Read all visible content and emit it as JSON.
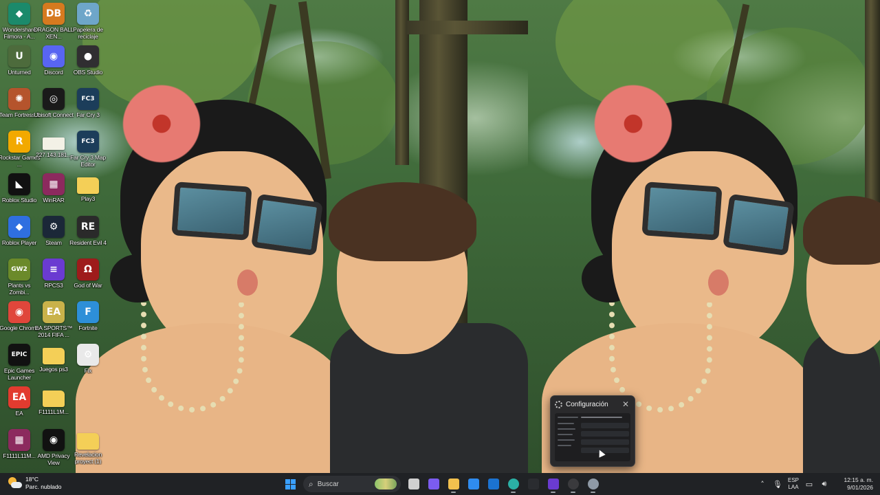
{
  "desktop": {
    "icons": [
      {
        "id": "filmora",
        "label": "Wondershare Filmora - A...",
        "glyph": "◆",
        "color": "#1b8a6b",
        "icon": "filmora-icon"
      },
      {
        "id": "dragonball",
        "label": "DRAGON BALL XEN...",
        "glyph": "DB",
        "color": "#d67a1f",
        "icon": "dragonball-icon"
      },
      {
        "id": "recycle",
        "label": "Papelera de reciclaje",
        "glyph": "♻",
        "color": "#6ea6c9",
        "icon": "recycle-bin-icon"
      },
      {
        "id": "unturned",
        "label": "Unturned",
        "glyph": "U",
        "color": "#4d6b3c",
        "icon": "unturned-icon"
      },
      {
        "id": "discord",
        "label": "Discord",
        "glyph": "◉",
        "color": "#5865f2",
        "icon": "discord-icon"
      },
      {
        "id": "obs",
        "label": "OBS Studio",
        "glyph": "●",
        "color": "#302e31",
        "icon": "obs-icon"
      },
      {
        "id": "tf2",
        "label": "Team Fortress 2",
        "glyph": "✺",
        "color": "#b5542c",
        "icon": "tf2-icon"
      },
      {
        "id": "ubisoft",
        "label": "Ubisoft Connect",
        "glyph": "◎",
        "color": "#1a1a1a",
        "icon": "ubisoft-icon"
      },
      {
        "id": "farcry3",
        "label": "Far Cry 3",
        "glyph": "FC3",
        "color": "#1c3d5a",
        "icon": "farcry3-icon"
      },
      {
        "id": "rockstar",
        "label": "Rockstar Games ...",
        "glyph": "R",
        "color": "#f2a900",
        "icon": "rockstar-icon"
      },
      {
        "id": "ipfile",
        "label": "227.143.181...",
        "glyph": "",
        "color": "#f3f1e6",
        "icon": "file-icon"
      },
      {
        "id": "farcry3editor",
        "label": "Far Cry 3 Map Editor",
        "glyph": "FC3",
        "color": "#1c3d5a",
        "icon": "farcry3-editor-icon"
      },
      {
        "id": "robloxstudio",
        "label": "Roblox Studio",
        "glyph": "◣",
        "color": "#111111",
        "icon": "roblox-studio-icon"
      },
      {
        "id": "winrar",
        "label": "WinRAR",
        "glyph": "▦",
        "color": "#8c2a5e",
        "icon": "winrar-icon"
      },
      {
        "id": "play3",
        "label": "Play3",
        "glyph": "",
        "color": "#f4cf57",
        "icon": "folder-icon"
      },
      {
        "id": "robloxplayer",
        "label": "Roblox Player",
        "glyph": "◆",
        "color": "#2f6fe0",
        "icon": "roblox-player-icon"
      },
      {
        "id": "steam",
        "label": "Steam",
        "glyph": "⚙",
        "color": "#1b2838",
        "icon": "steam-icon"
      },
      {
        "id": "re4",
        "label": "Resident Evil 4",
        "glyph": "RE",
        "color": "#2a2a2a",
        "icon": "resident-evil-icon"
      },
      {
        "id": "pvz",
        "label": "Plants vs Zombi...",
        "glyph": "GW2",
        "color": "#6b8a2a",
        "icon": "plants-vs-zombies-icon"
      },
      {
        "id": "rpcs3",
        "label": "RPCS3",
        "glyph": "≡",
        "color": "#6a3bd1",
        "icon": "rpcs3-icon"
      },
      {
        "id": "gow",
        "label": "God of War",
        "glyph": "Ω",
        "color": "#9e1b1b",
        "icon": "god-of-war-icon"
      },
      {
        "id": "chrome",
        "label": "Google Chrome",
        "glyph": "◉",
        "color": "#e0463b",
        "icon": "chrome-icon"
      },
      {
        "id": "fifa",
        "label": "EA SPORTS™ 2014 FIFA ...",
        "glyph": "EA",
        "color": "#c9b24a",
        "icon": "fifa-icon"
      },
      {
        "id": "fortnite",
        "label": "Fortnite",
        "glyph": "F",
        "color": "#2d8fd8",
        "icon": "fortnite-icon"
      },
      {
        "id": "epic",
        "label": "Epic Games Launcher",
        "glyph": "EPIC",
        "color": "#111111",
        "icon": "epic-games-icon"
      },
      {
        "id": "juegosps3",
        "label": "Juegos ps3",
        "glyph": "",
        "color": "#f4cf57",
        "icon": "folder-icon"
      },
      {
        "id": "fix",
        "label": "Fix",
        "glyph": "⚙",
        "color": "#e9e9e9",
        "icon": "settings-file-icon"
      },
      {
        "id": "ea",
        "label": "EA",
        "glyph": "EA",
        "color": "#e23b2f",
        "icon": "ea-icon"
      },
      {
        "id": "f1111",
        "label": "F1111L1M...",
        "glyph": "",
        "color": "#f4cf57",
        "icon": "folder-icon"
      },
      {
        "id": "f1111b",
        "label": "F1111L11M...",
        "glyph": "▦",
        "color": "#8c2a5e",
        "icon": "winrar-archive-icon"
      },
      {
        "id": "amd",
        "label": "AMD Privacy View",
        "glyph": "◉",
        "color": "#111111",
        "icon": "amd-privacy-view-icon"
      },
      {
        "id": "revelacion",
        "label": "Revelacion proyect (1)",
        "glyph": "",
        "color": "#f4cf57",
        "icon": "folder-image-icon"
      }
    ]
  },
  "taskbar": {
    "weather": {
      "temp": "18°C",
      "condition": "Parc. nublado"
    },
    "search_placeholder": "Buscar",
    "apps": [
      {
        "id": "start",
        "icon": "windows-start-icon"
      },
      {
        "id": "taskview",
        "icon": "task-view-icon",
        "color": "#d0d0d0"
      },
      {
        "id": "copilot",
        "icon": "copilot-icon",
        "color": "#7b5cf0"
      },
      {
        "id": "explorer",
        "icon": "file-explorer-icon",
        "color": "#f2c14e"
      },
      {
        "id": "store",
        "icon": "microsoft-store-icon",
        "color": "#2f8cf0"
      },
      {
        "id": "outlook",
        "icon": "outlook-icon",
        "color": "#1b73d1"
      },
      {
        "id": "edge",
        "icon": "edge-icon",
        "color": "#2bb0a5"
      },
      {
        "id": "blank",
        "icon": "app-icon",
        "color": "#2a2c30"
      },
      {
        "id": "rpcs3",
        "icon": "rpcs3-icon",
        "color": "#6a3bd1"
      },
      {
        "id": "obs",
        "icon": "obs-icon",
        "color": "#3a3a3d"
      },
      {
        "id": "settings",
        "icon": "settings-icon",
        "color": "#8f9aa6"
      }
    ],
    "tray": {
      "lang_top": "ESP",
      "lang_bottom": "LAA",
      "time": "12:15 a. m.",
      "date": "9/01/2026"
    }
  },
  "thumbnail": {
    "title": "Configuración"
  }
}
